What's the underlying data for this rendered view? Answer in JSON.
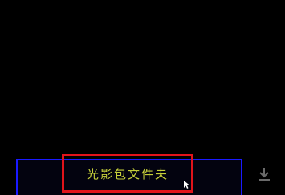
{
  "bottom_bar": {
    "file_label": "光影包文件夫"
  },
  "icons": {
    "download": "download-icon",
    "cursor": "mouse-cursor-icon"
  },
  "colors": {
    "background": "#000000",
    "panel_border": "#1a1aff",
    "highlight": "#e0141a",
    "label_text": "#c6cf3a",
    "icon": "#6a6a6a"
  }
}
